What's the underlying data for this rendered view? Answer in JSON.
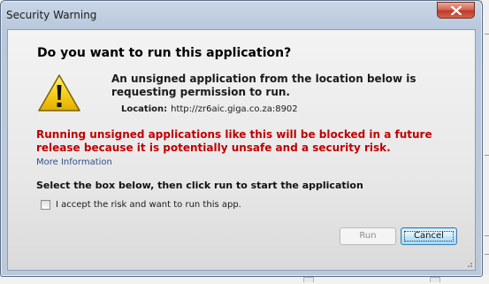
{
  "window": {
    "title": "Security Warning"
  },
  "dialog": {
    "heading": "Do you want to run this application?",
    "message": "An unsigned application from the location below is requesting permission to run.",
    "location_label": "Location:",
    "location_value": "http://zr6aic.giga.co.za:8902",
    "red_warning": "Running unsigned applications like this will be blocked in a future release because it is potentially unsafe and a security risk.",
    "more_info_link": "More Information",
    "instruction": "Select the box below, then click run to start the application",
    "checkbox_label": "I accept the risk and want to run this app.",
    "checkbox_checked": false
  },
  "buttons": {
    "run_label": "Run",
    "run_enabled": false,
    "cancel_label": "Cancel"
  },
  "icons": {
    "warning": "warning-triangle-icon",
    "close": "close-icon"
  },
  "colors": {
    "warning_text": "#c00000",
    "link": "#2c4f8c",
    "icon_yellow": "#f6d21c"
  }
}
